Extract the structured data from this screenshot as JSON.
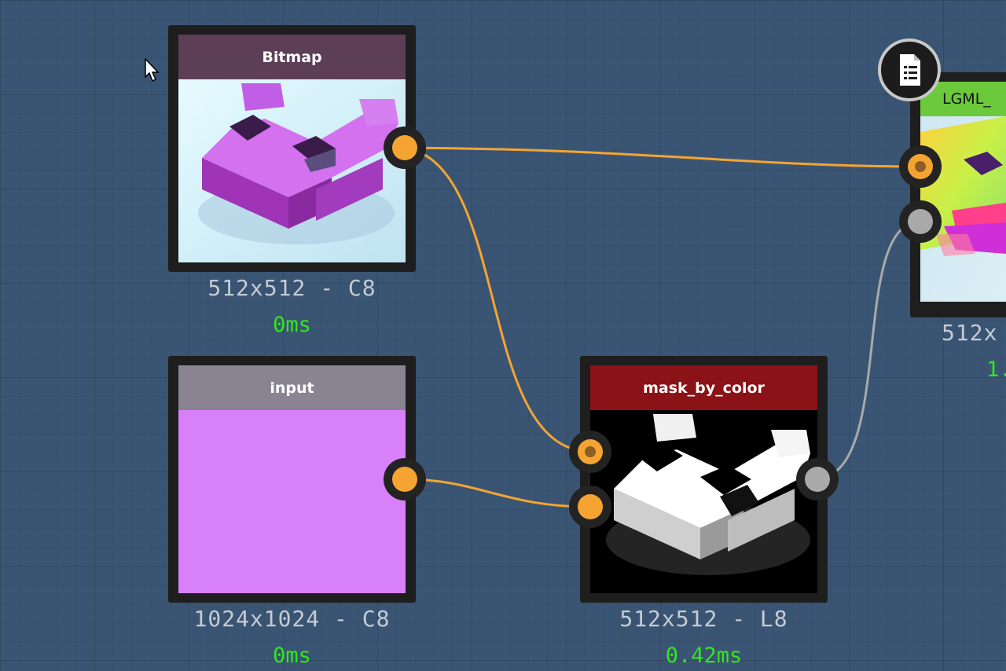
{
  "nodes": {
    "bitmap": {
      "title": "Bitmap",
      "header_color": "#5c3f57",
      "resolution": "512x512 - C8",
      "time": "0ms"
    },
    "input": {
      "title": "input",
      "header_color": "#8a8492",
      "preview_color": "#d880fa",
      "resolution": "1024x1024 - C8",
      "time": "0ms"
    },
    "mask_by_color": {
      "title": "mask_by_color",
      "header_color": "#8b1216",
      "resolution": "512x512 - L8",
      "time": "0.42ms"
    },
    "lgml": {
      "title": "LGML_",
      "header_color": "#6cc93c",
      "resolution": "512x",
      "time": "1."
    }
  },
  "colors": {
    "canvas_background": "#3a5573",
    "wire_color_output": "#f5a432",
    "wire_color_mask": "#a9a9a9",
    "time_color": "#33e61c"
  },
  "icons": {
    "document_badge": "document-list-icon",
    "cursor": "mouse-pointer-icon"
  }
}
